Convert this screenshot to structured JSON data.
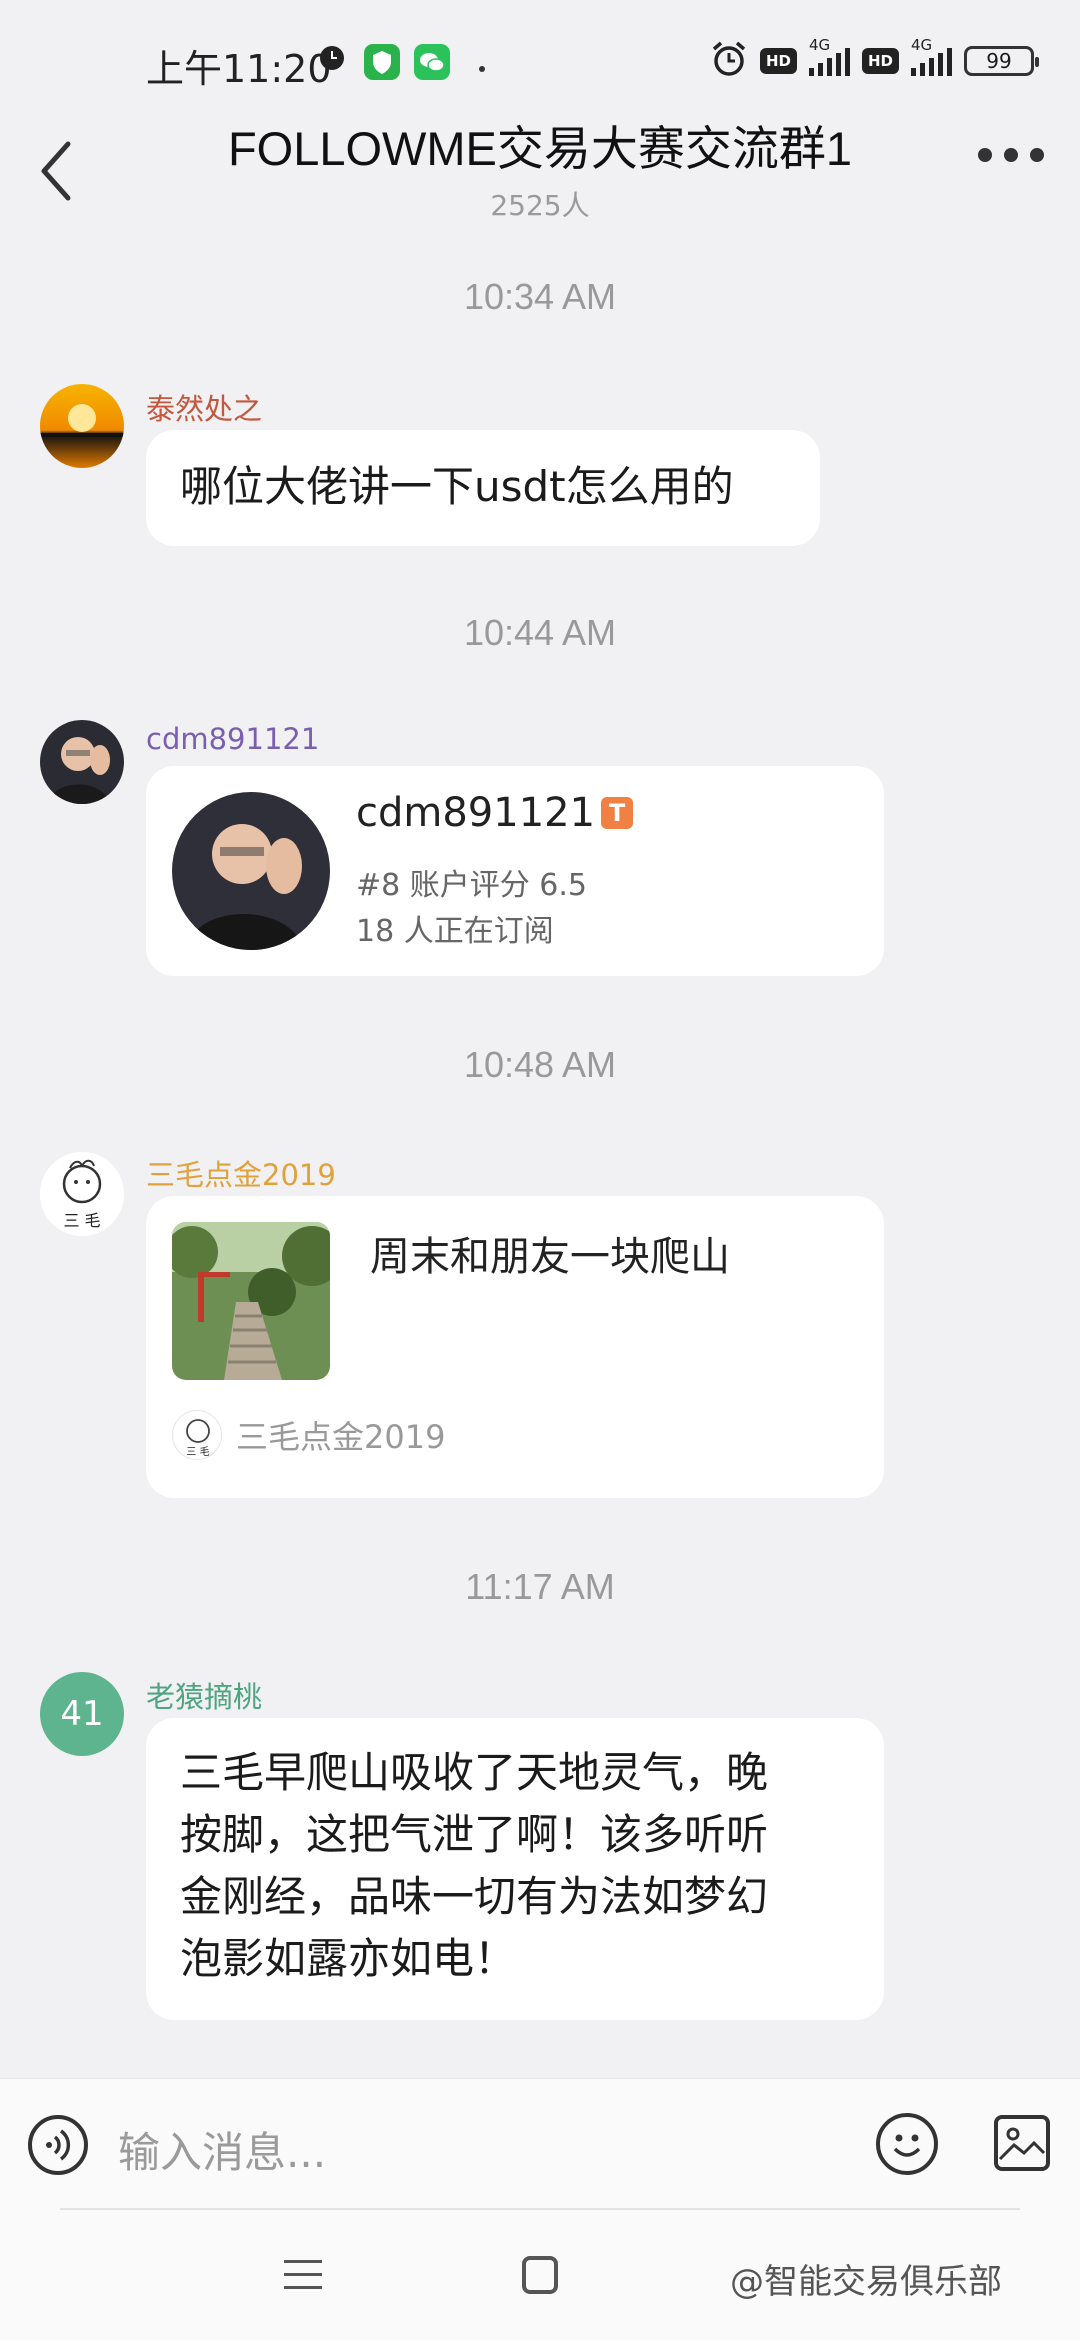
{
  "status_bar": {
    "time": "上午11:20",
    "signal_tag": "4G",
    "hd_label": "HD",
    "battery": "99"
  },
  "header": {
    "title": "FOLLOWME交易大赛交流群1",
    "member_count": "2525人"
  },
  "timestamps": [
    "10:34 AM",
    "10:44 AM",
    "10:48 AM",
    "11:17 AM"
  ],
  "messages": [
    {
      "sender": "泰然处之",
      "sender_color": "#c4573e",
      "text": "哪位大佬讲一下usdt怎么用的"
    },
    {
      "sender": "cdm891121",
      "sender_color": "#7a5fb0",
      "card": {
        "name": "cdm891121",
        "badge": "T",
        "rank_line": "#8 账户评分 6.5",
        "subs_line": "18 人正在订阅"
      }
    },
    {
      "sender": "三毛点金2019",
      "sender_color": "#e0a23a",
      "post": {
        "text": "周末和朋友一块爬山",
        "author": "三毛点金2019"
      }
    },
    {
      "sender": "老猿摘桃",
      "sender_color": "#4fa582",
      "avatar_text": "41",
      "lines": [
        "三毛早爬山吸收了天地灵气，晚",
        "按脚，这把气泄了啊！该多听听",
        "金刚经，品味一切有为法如梦幻",
        "泡影如露亦如电！"
      ]
    }
  ],
  "input": {
    "placeholder": "输入消息..."
  },
  "watermark": "@智能交易俱乐部",
  "colors": {
    "accent_badge": "#f08142",
    "background": "#f1f1f3"
  }
}
